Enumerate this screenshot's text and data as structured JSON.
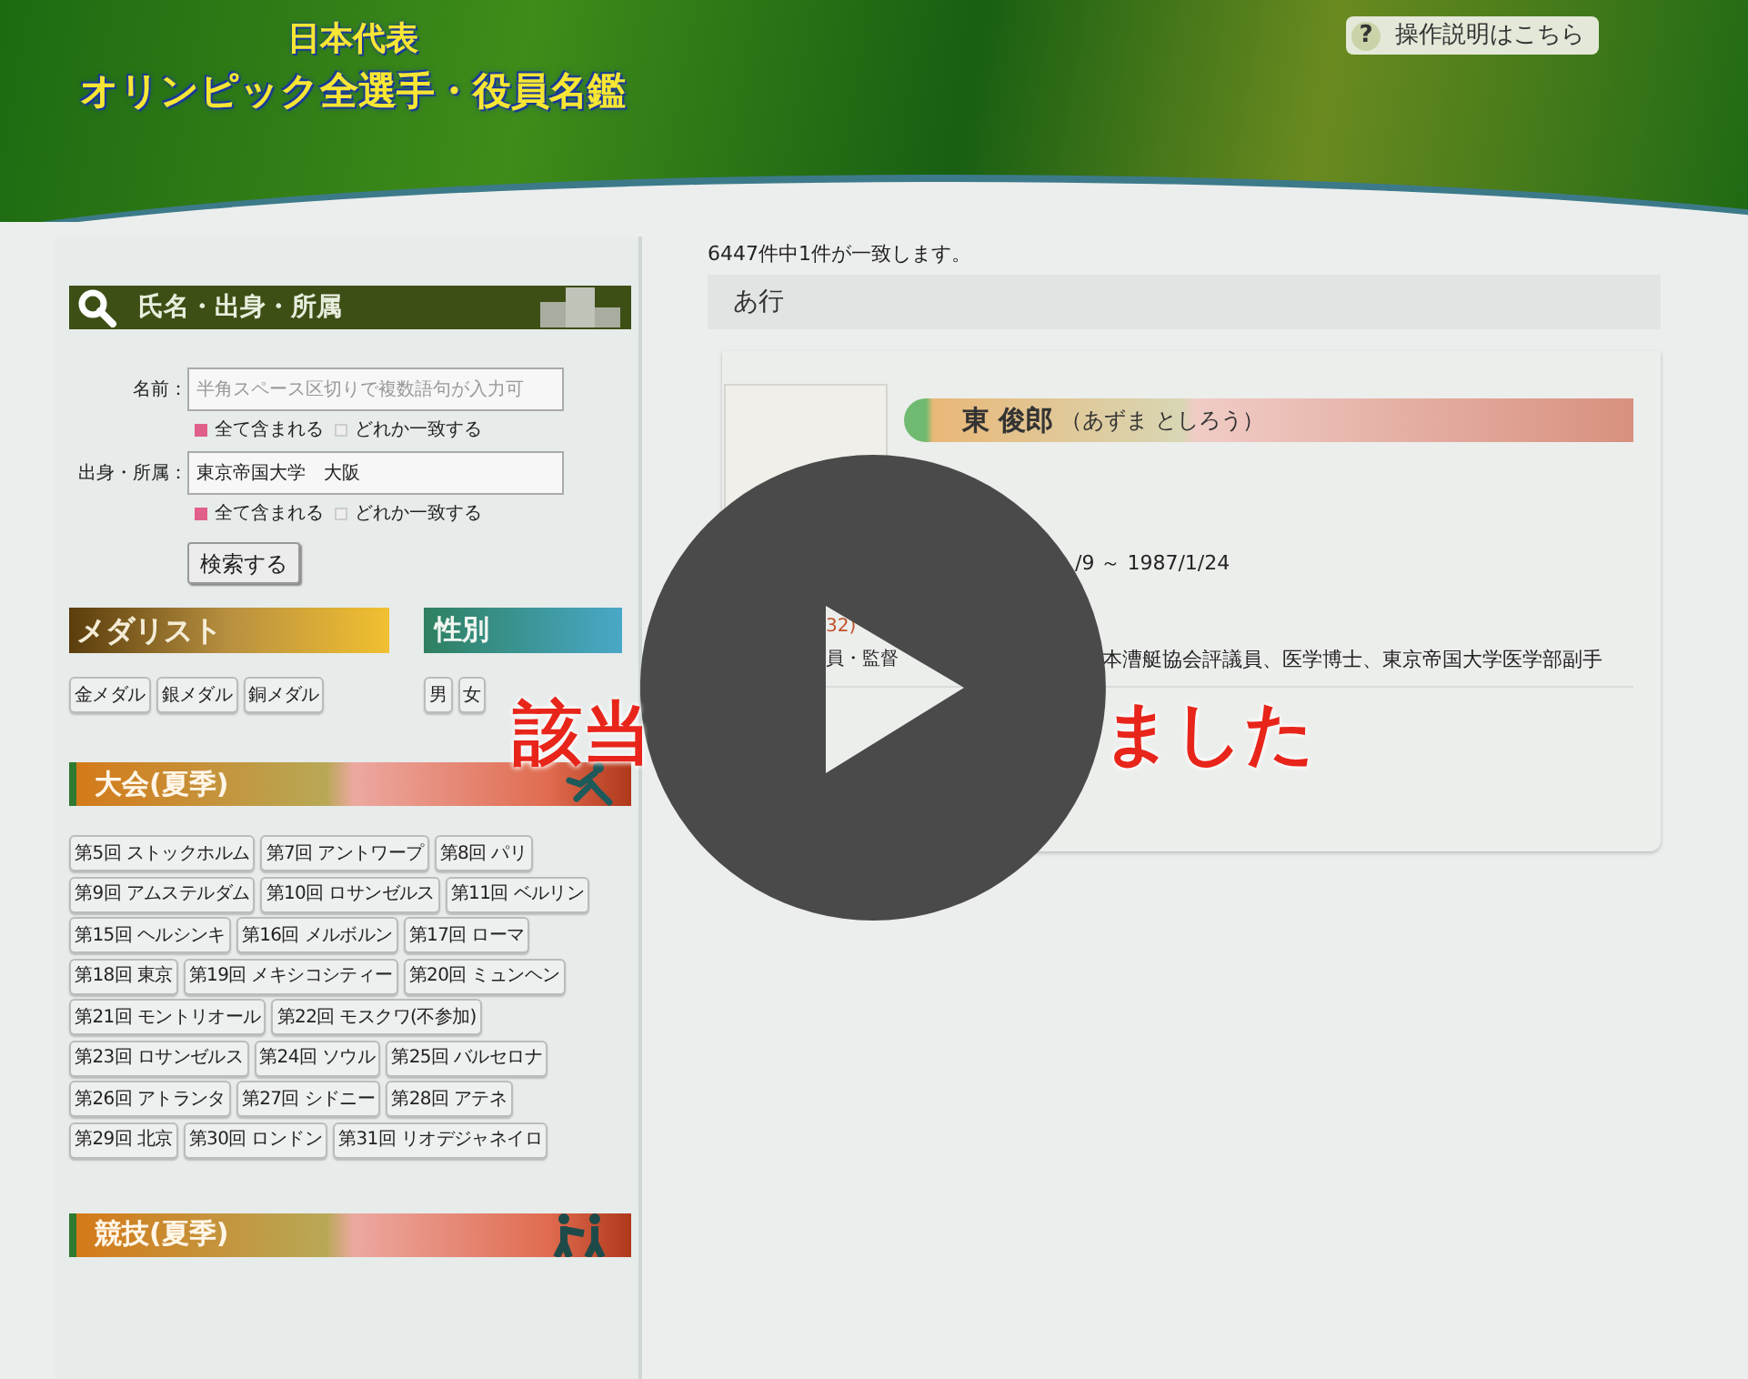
{
  "header": {
    "title_line1": "日本代表",
    "title_line2": "オリンピック全選手・役員名鑑",
    "help_button": {
      "icon": "?",
      "label": "操作説明はこちら"
    }
  },
  "search": {
    "title": "氏名・出身・所属",
    "fields": [
      {
        "label": "名前：",
        "placeholder": "半角スペース区切りで複数語句が入力可",
        "options": [
          {
            "label": "全て含まれる",
            "selected": true
          },
          {
            "label": "どれか一致する",
            "selected": false
          }
        ]
      },
      {
        "label": "出身・所属：",
        "value": "東京帝国大学　大阪",
        "options": [
          {
            "label": "全て含まれる",
            "selected": true
          },
          {
            "label": "どれか一致する",
            "selected": false
          }
        ]
      }
    ],
    "button": "検索する"
  },
  "medalist": {
    "title": "メダリスト",
    "buttons": [
      "金メダル",
      "銀メダル",
      "銅メダル"
    ]
  },
  "gender": {
    "title": "性別",
    "buttons": [
      "男",
      "女"
    ]
  },
  "summer_games": {
    "title": "大会(夏季)",
    "buttons": [
      "第5回 ストックホルム",
      "第7回 アントワープ",
      "第8回 パリ",
      "第9回 アムステルダム",
      "第10回 ロサンゼルス",
      "第11回 ベルリン",
      "第15回 ヘルシンキ",
      "第16回 メルボルン",
      "第17回 ローマ",
      "第18回 東京",
      "第19回 メキシコシティー",
      "第20回 ミュンヘン",
      "第21回 モントリオール",
      "第22回 モスクワ(不参加)",
      "第23回 ロサンゼルス",
      "第24回 ソウル",
      "第25回 バルセロナ",
      "第26回 アトランタ",
      "第27回 シドニー",
      "第28回 アテネ",
      "第29回 北京",
      "第30回 ロンドン",
      "第31回 リオデジャネイロ"
    ]
  },
  "summer_sports": {
    "title": "競技(夏季)"
  },
  "results": {
    "count": "6447件中1件が一致します。",
    "group": "あ行",
    "person": {
      "name": "東 俊郎",
      "reading": "（あずま としろう）",
      "dates": "/9 ～ 1987/1/24",
      "roles": [
        {
          "number": "32)",
          "role": "員・監督",
          "detail": "本漕艇協会評議員、医学博士、東京帝国大学医学部副手"
        }
      ]
    }
  },
  "video_overlay": {
    "caption_parts": [
      "該当",
      "ました"
    ]
  }
}
